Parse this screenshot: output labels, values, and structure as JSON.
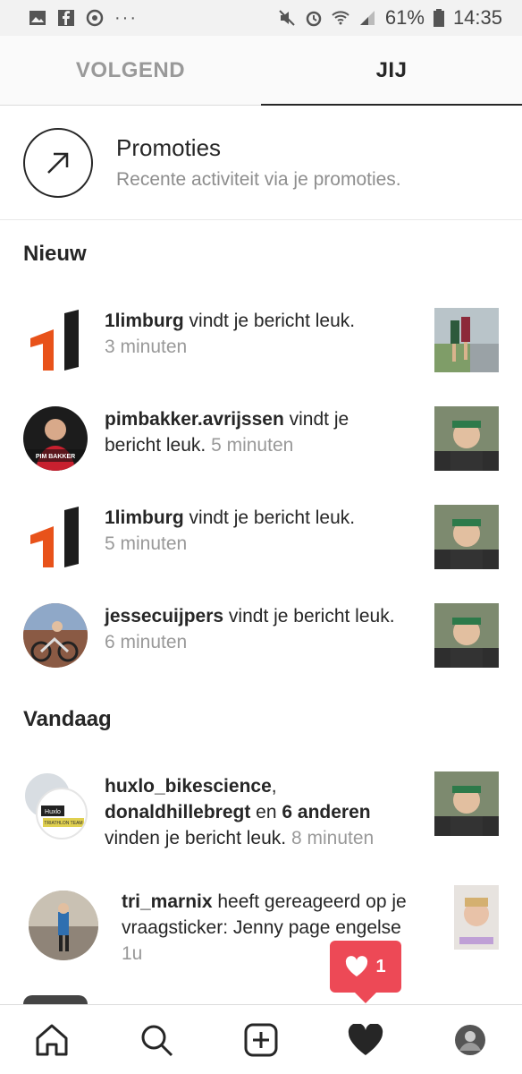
{
  "status": {
    "battery": "61%",
    "time": "14:35"
  },
  "tabs": [
    {
      "label": "VOLGEND"
    },
    {
      "label": "JIJ"
    }
  ],
  "promo": {
    "title": "Promoties",
    "subtitle": "Recente activiteit via je promoties."
  },
  "sections": {
    "new": "Nieuw",
    "today": "Vandaag"
  },
  "items": [
    {
      "user": "1limburg",
      "text": " vindt je bericht leuk.",
      "time": "3 minuten"
    },
    {
      "user": "pimbakker.avrijssen",
      "text": " vindt je bericht leuk.",
      "time": "5 minuten"
    },
    {
      "user": "1limburg",
      "text": " vindt je bericht leuk.",
      "time": "5 minuten"
    },
    {
      "user": "jessecuijpers",
      "text": " vindt je bericht leuk.",
      "time": "6 minuten"
    },
    {
      "user": "huxlo_bikescience",
      "user2": "donaldhillebregt",
      "mid": " en ",
      "others": "6 anderen",
      "text": " vinden je bericht leuk.",
      "time": "8 minuten"
    },
    {
      "user": "tri_marnix",
      "text": " heeft gereageerd op je vraagsticker: Jenny page engelse",
      "time": "1u"
    }
  ],
  "avatar_texts": {
    "pim": "PIM BAKKER",
    "huxlo": "Huxlo",
    "triathlon": "TRIATHLON TEAM"
  },
  "toast": {
    "count": "1"
  },
  "colors": {
    "brand_orange": "#e8521a",
    "like_red": "#ed4956",
    "text_dark": "#262626",
    "text_muted": "#999999"
  },
  "icons": [
    "image-icon",
    "facebook-icon",
    "sync-icon",
    "more-icon",
    "mute-icon",
    "alarm-icon",
    "wifi-icon",
    "signal-icon",
    "battery-icon",
    "arrow-up-right-icon",
    "home-icon",
    "search-icon",
    "add-icon",
    "heart-icon",
    "profile-icon"
  ]
}
